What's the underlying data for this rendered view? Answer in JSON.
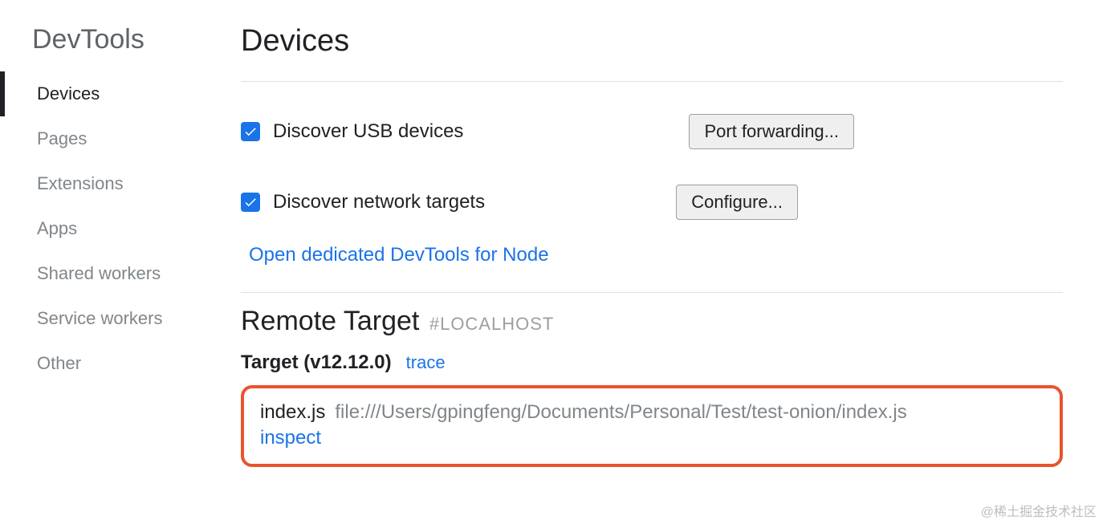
{
  "sidebar": {
    "title": "DevTools",
    "items": [
      {
        "label": "Devices",
        "active": true
      },
      {
        "label": "Pages",
        "active": false
      },
      {
        "label": "Extensions",
        "active": false
      },
      {
        "label": "Apps",
        "active": false
      },
      {
        "label": "Shared workers",
        "active": false
      },
      {
        "label": "Service workers",
        "active": false
      },
      {
        "label": "Other",
        "active": false
      }
    ]
  },
  "main": {
    "title": "Devices",
    "discover_usb": {
      "label": "Discover USB devices",
      "checked": true,
      "button": "Port forwarding..."
    },
    "discover_network": {
      "label": "Discover network targets",
      "checked": true,
      "button": "Configure..."
    },
    "dedicated_link": "Open dedicated DevTools for Node",
    "remote": {
      "title": "Remote Target",
      "subtitle": "#LOCALHOST",
      "target_label": "Target (v12.12.0)",
      "trace": "trace",
      "file_name": "index.js",
      "file_path": "file:///Users/gpingfeng/Documents/Personal/Test/test-onion/index.js",
      "inspect": "inspect"
    }
  },
  "watermark": "@稀土掘金技术社区"
}
